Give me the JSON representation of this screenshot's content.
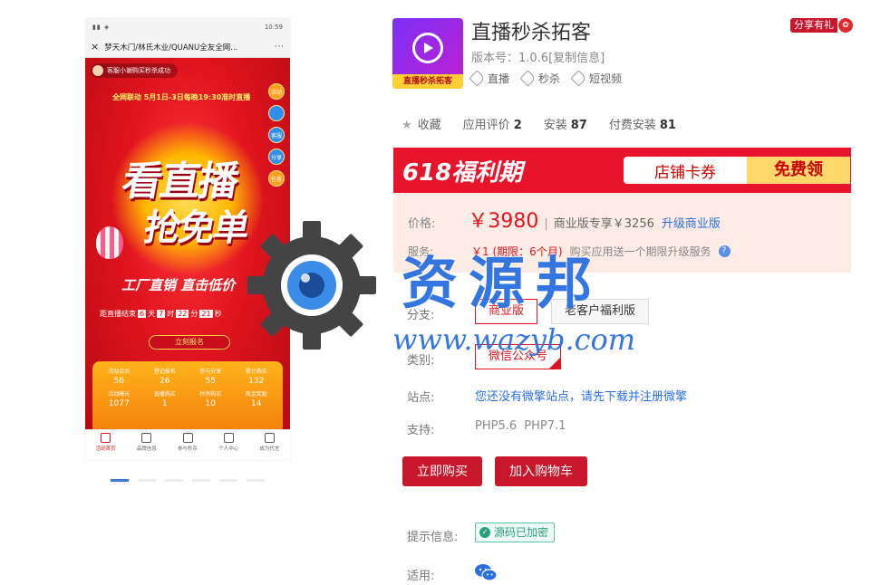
{
  "phone": {
    "status_time": "10:59",
    "status_signal": "▮▮ ◈",
    "nav_close": "×",
    "nav_title": "梦天木门/林氏木业/QUANU全友全网...",
    "nav_more": "···",
    "notice": "客服小谢购买秒杀成功",
    "live_tag": "全网联动 5月1日-3日每晚19:30准时直播",
    "headline1": "看直播",
    "headline2": "抢免单",
    "slogan": "工厂直销 直击低价",
    "countdown_label": "距直播结束",
    "countdown": [
      "6",
      "天",
      "7",
      "时",
      "22",
      "分",
      "21",
      "秒"
    ],
    "signup_label": "立刻报名",
    "side_icons": [
      "活动",
      "",
      "客服",
      "分享",
      "任务"
    ],
    "stats": [
      [
        {
          "label": "活动会员",
          "value": "56"
        },
        {
          "label": "登记报名",
          "value": "26"
        },
        {
          "label": "参与分享",
          "value": "55"
        },
        {
          "label": "累计购买",
          "value": "132"
        }
      ],
      [
        {
          "label": "活动曝光",
          "value": "1077"
        },
        {
          "label": "直播购买",
          "value": "1"
        },
        {
          "label": "秒杀购买",
          "value": "10"
        },
        {
          "label": "现金奖励",
          "value": "14"
        }
      ]
    ],
    "tabs": [
      "活动首页",
      "品牌信息",
      "参与秒杀",
      "个人中心",
      "成为代言"
    ],
    "android_nav": [
      "◁",
      "○",
      "□"
    ]
  },
  "watermark": {
    "title": "资源邦",
    "url": "www.wazyb.com"
  },
  "app": {
    "icon_caption": "直播秒杀拓客",
    "title": "直播秒杀拓客",
    "version": "版本号：1.0.6[复制信息]",
    "tags": [
      "直播",
      "秒杀",
      "短视频"
    ],
    "share_label": "分享有礼",
    "share_gift": "✿"
  },
  "metrics": {
    "favorite_label": "收藏",
    "rating_label": "应用评价",
    "rating_value": "2",
    "install_label": "安装",
    "install_value": "87",
    "paid_label": "付费安装",
    "paid_value": "81"
  },
  "banner": {
    "title": "618福利期",
    "coupon_label": "店铺卡券",
    "coupon_action": "免费领"
  },
  "pricing": {
    "price_label": "价格:",
    "price_value": "￥3980",
    "separator": "|",
    "biz_text": "商业版专享￥3256",
    "upgrade_link": "升级商业版",
    "service_label": "服务:",
    "service_value": "￥1 (期限：6个月)",
    "service_desc": "购买应用送一个期限升级服务",
    "service_help": "?"
  },
  "options": {
    "branch_label": "分支:",
    "branch_options": [
      "商业版",
      "老客户福利版"
    ],
    "type_label": "类别:",
    "type_options": [
      "微信公众号"
    ],
    "site_label": "站点:",
    "site_text": "您还没有微擎站点，请先下载并注册微擎",
    "support_label": "支持:",
    "support_text": "PHP5.6 PHP7.1"
  },
  "actions": {
    "buy": "立即购买",
    "cart": "加入购物车"
  },
  "footer": {
    "hint_label": "提示信息:",
    "hint_badge": "源码已加密",
    "hint_check": "✓",
    "apply_label": "适用:"
  },
  "colors": {
    "accent_red": "#c8162b",
    "link_blue": "#2a6fe0",
    "price_red": "#e0141e",
    "encrypted_green": "#2a9f7c"
  }
}
